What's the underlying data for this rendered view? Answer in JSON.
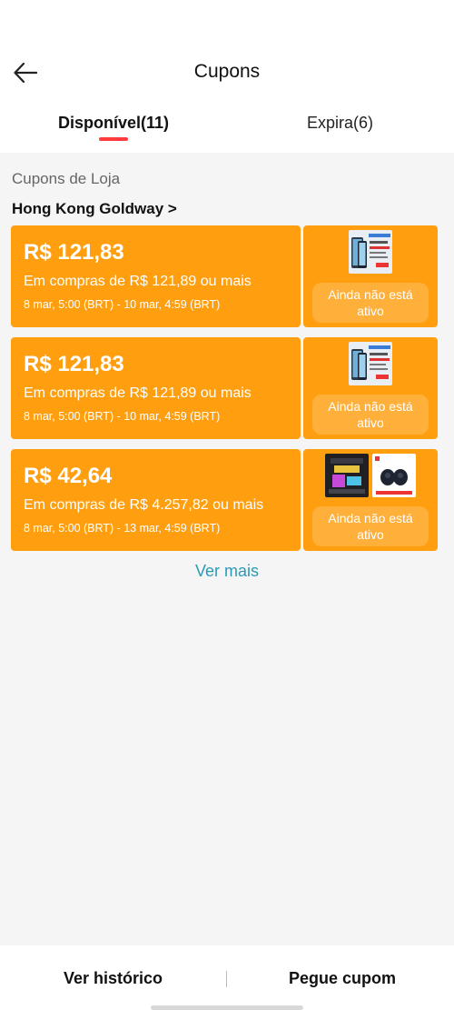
{
  "header": {
    "title": "Cupons"
  },
  "tabs": [
    {
      "label": "Disponível(11)",
      "active": true
    },
    {
      "label": "Expira(6)",
      "active": false
    }
  ],
  "section": {
    "title": "Cupons de Loja",
    "store": "Hong Kong Goldway >"
  },
  "coupons": [
    {
      "amount": "R$ 121,83",
      "condition": "Em compras de R$ 121,89 ou mais",
      "validity": "8 mar, 5:00 (BRT) - 10 mar, 4:59 (BRT)",
      "status": "Ainda não está ativo"
    },
    {
      "amount": "R$ 121,83",
      "condition": "Em compras de R$ 121,89 ou mais",
      "validity": "8 mar, 5:00 (BRT) - 10 mar, 4:59 (BRT)",
      "status": "Ainda não está ativo"
    },
    {
      "amount": "R$ 42,64",
      "condition": "Em compras de R$ 4.257,82 ou mais",
      "validity": "8 mar, 5:00 (BRT) - 13 mar, 4:59 (BRT)",
      "status": "Ainda não está ativo"
    }
  ],
  "see_more": "Ver mais",
  "footer": {
    "history_label": "Ver histórico",
    "get_label": "Pegue cupom"
  },
  "colors": {
    "accent": "#ff9f10",
    "tab_indicator": "#ff3b3b",
    "link": "#2a9bb7"
  }
}
